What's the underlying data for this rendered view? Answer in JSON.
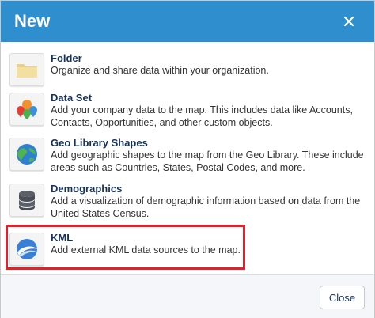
{
  "dialog": {
    "title": "New",
    "close_icon": "close-icon"
  },
  "items": [
    {
      "icon": "folder-icon",
      "title": "Folder",
      "description": "Organize and share data within your organization."
    },
    {
      "icon": "map-pins-icon",
      "title": "Data Set",
      "description": "Add your company data to the map. This includes data like Accounts, Contacts, Opportunities, and other custom objects."
    },
    {
      "icon": "globe-icon",
      "title": "Geo Library Shapes",
      "description": "Add geographic shapes to the map from the Geo Library. These include areas such as Countries, States, Postal Codes, and more."
    },
    {
      "icon": "database-icon",
      "title": "Demographics",
      "description": "Add a visualization of demographic information based on data from the United States Census."
    },
    {
      "icon": "earth-kml-icon",
      "title": "KML",
      "description": "Add external KML data sources to the map."
    }
  ],
  "footer": {
    "close_label": "Close"
  },
  "colors": {
    "header": "#2f8fce",
    "highlight": "#e3212b",
    "title_text": "#16325c"
  }
}
